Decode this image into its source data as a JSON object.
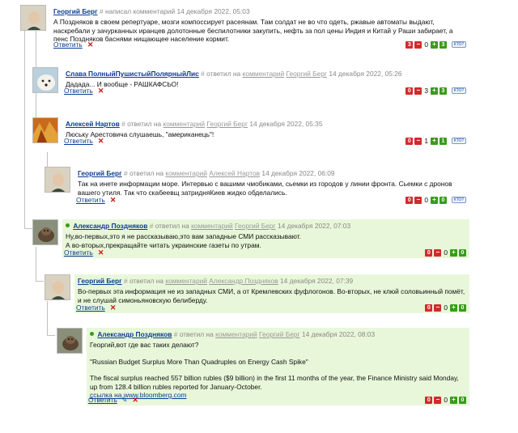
{
  "comments": [
    {
      "author": "Георгий Берг",
      "hash": "#",
      "meta": "написал комментарий 14 декабря 2022, 05:03",
      "meta_prefix": "",
      "meta_ref_author": "",
      "lines": [
        "А Поздняков в своем репертуаре, мозги компоссирует расеянам. Там солдат не во что одеть, ржавые автоматы выдают, наскребали у зачурканных иранцев долотонные беспилотники закупить, нефть за пол цены Индия и Китай у Раши забирает, а пенс Поздняков баснями нищающее население кормит."
      ],
      "reply": "Ответить",
      "votes": {
        "neg": "3",
        "score": "0",
        "pos": "3"
      },
      "who": "КТО?"
    },
    {
      "author": "Слава ПолныйПушистыйПолярныйЛис",
      "hash": "#",
      "meta_prefix": "ответил на",
      "meta_ref": "комментарий",
      "meta_ref_author": "Георгий Берг",
      "date": "14 декабря 2022, 05:26",
      "lines": [
        "Дадада... И вообще - РАШКАФСЬО!"
      ],
      "reply": "Ответить",
      "votes": {
        "neg": "0",
        "score": "3",
        "pos": "3"
      },
      "who": "КТО?"
    },
    {
      "author": "Алексей Нартов",
      "hash": "#",
      "meta_prefix": "ответил на",
      "meta_ref": "комментарий",
      "meta_ref_author": "Георгий Берг",
      "date": "14 декабря 2022, 05:35",
      "lines": [
        "Люську Арестовича слушаешь, \"американець\"!"
      ],
      "reply": "Ответить",
      "votes": {
        "neg": "0",
        "score": "1",
        "pos": "1"
      },
      "who": "КТО?"
    },
    {
      "author": "Георгий Берг",
      "hash": "#",
      "meta_prefix": "ответил на",
      "meta_ref": "комментарий",
      "meta_ref_author": "Алексей Нартов",
      "date": "14 декабря 2022, 06:09",
      "lines": [
        "Так на инете информации море. Интервью с вашими чмобиками, сьемки из городов у линии фронта. Сьемки с дронов вашего утиля. Так что скабеевщ затридняКиев жидко обделались."
      ],
      "reply": "Ответить",
      "votes": {
        "neg": "0",
        "score": "0",
        "pos": "0"
      },
      "who": "КТО?"
    },
    {
      "author": "Александр Поздняков",
      "hash": "#",
      "meta_prefix": "ответил на",
      "meta_ref": "комментарий",
      "meta_ref_author": "Георгий Берг",
      "date": "14 декабря 2022, 07:03",
      "lines": [
        "Ну,во-первых,это я не рассказываю,это вам западные СМИ рассказывают.",
        "А во-вторых,прекращайте читать украинские газеты по утрам."
      ],
      "reply": "Ответить",
      "votes": {
        "neg": "0",
        "score": "0",
        "pos": "0"
      }
    },
    {
      "author": "Георгий Берг",
      "hash": "#",
      "meta_prefix": "ответил на",
      "meta_ref": "комментарий",
      "meta_ref_author": "Александр Поздняков",
      "date": "14 декабря 2022, 07:39",
      "lines": [
        "Во-первых эта информация не из западных СМИ, а от Кремлевских фуфлогонов. Во-вторых, не клюй соловьинный помёт, и не слушай симоньяновскую белиберду."
      ],
      "reply": "Ответить",
      "votes": {
        "neg": "0",
        "score": "0",
        "pos": "0"
      }
    },
    {
      "author": "Александр Поздняков",
      "hash": "#",
      "meta_prefix": "ответил на",
      "meta_ref": "комментарий",
      "meta_ref_author": "Георгий Берг",
      "date": "14 декабря 2022, 08:03",
      "lines": [
        "Георгий,вот где вас таких делают?",
        "",
        "\"Russian Budget Surplus More Than Quadruples on Energy Cash Spike\"",
        "",
        "The fiscal surplus reached 557 billion rubles ($9 billion) in the first 11 months of the year, the Finance Ministry said Monday, up from 128.4 billion rubles reported for January-October."
      ],
      "link": "ссылка на www.bloomberg.com",
      "reply": "Ответить",
      "votes": {
        "neg": "0",
        "score": "0",
        "pos": "0"
      }
    }
  ]
}
